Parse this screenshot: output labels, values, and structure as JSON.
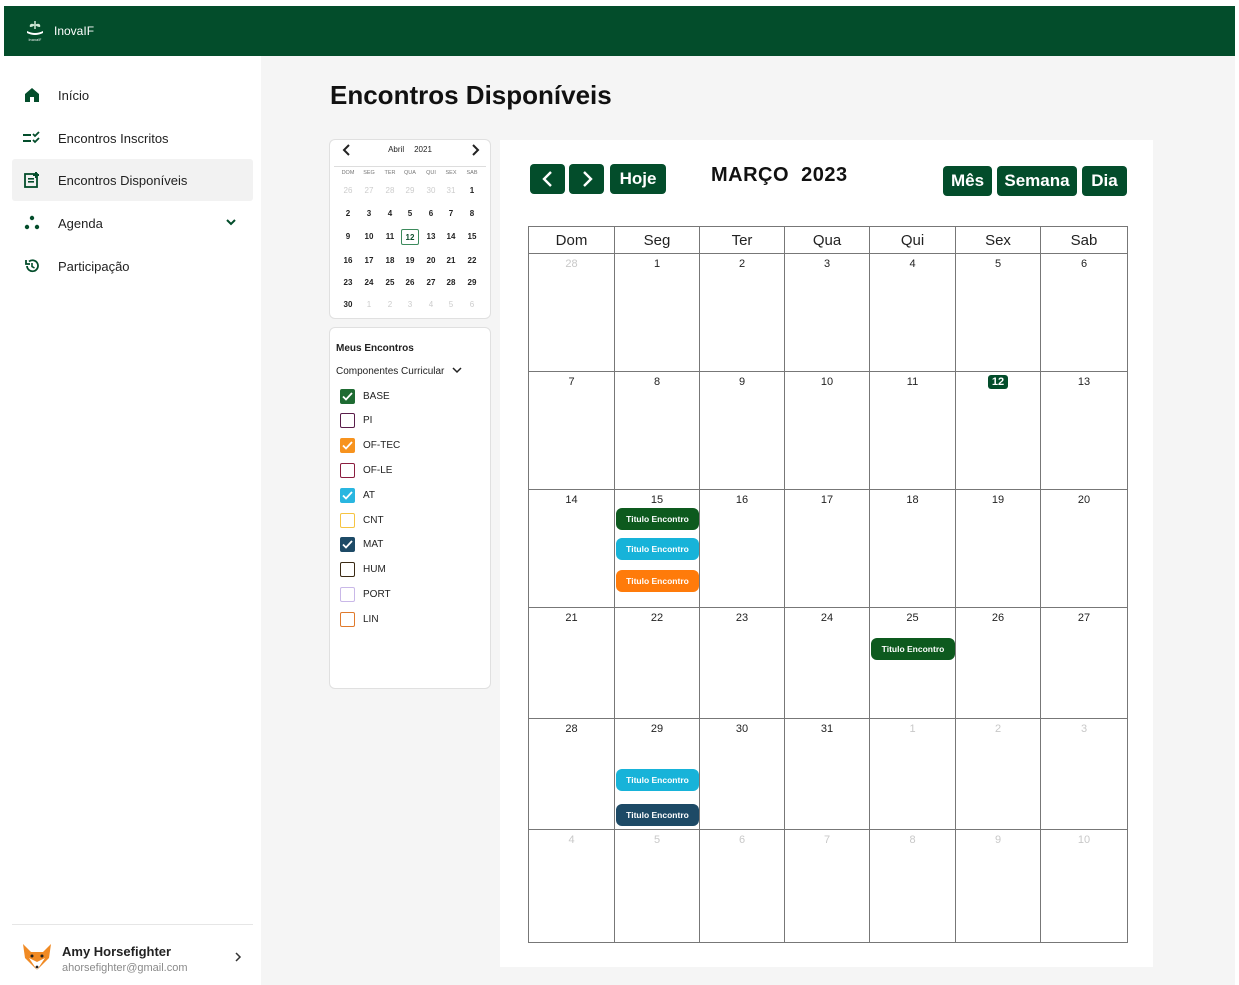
{
  "app": {
    "name": "InovaIF",
    "logo_text": "InovaIF"
  },
  "nav": {
    "items": [
      {
        "label": "Início",
        "icon": "home-icon"
      },
      {
        "label": "Encontros Inscritos",
        "icon": "checklist-icon"
      },
      {
        "label": "Encontros Disponíveis",
        "icon": "note-add-icon",
        "active": true
      },
      {
        "label": "Agenda",
        "icon": "dots-icon",
        "expandable": true
      },
      {
        "label": "Participação",
        "icon": "history-icon"
      }
    ]
  },
  "user": {
    "name": "Amy Horsefighter",
    "email": "ahorsefighter@gmail.com"
  },
  "page": {
    "title": "Encontros Disponíveis"
  },
  "mini_calendar": {
    "month": "Abril",
    "year": "2021",
    "weekdays": [
      "DOM",
      "SEG",
      "TER",
      "QUA",
      "QUI",
      "SEX",
      "SAB"
    ],
    "weeks": [
      [
        "26",
        "27",
        "28",
        "29",
        "30",
        "31",
        "1"
      ],
      [
        "2",
        "3",
        "4",
        "5",
        "6",
        "7",
        "8"
      ],
      [
        "9",
        "10",
        "11",
        "12",
        "13",
        "14",
        "15"
      ],
      [
        "16",
        "17",
        "18",
        "19",
        "20",
        "21",
        "22"
      ],
      [
        "23",
        "24",
        "25",
        "26",
        "27",
        "28",
        "29"
      ],
      [
        "30",
        "1",
        "2",
        "3",
        "4",
        "5",
        "6"
      ]
    ],
    "selected": "12"
  },
  "filters": {
    "title": "Meus Encontros",
    "group_label": "Componentes Curricular",
    "items": [
      {
        "label": "BASE",
        "checked": true,
        "color": "#1e6b32"
      },
      {
        "label": "PI",
        "checked": false,
        "color": "#5a1d4a"
      },
      {
        "label": "OF-TEC",
        "checked": true,
        "color": "#f7931e"
      },
      {
        "label": "OF-LE",
        "checked": false,
        "color": "#8b1d3f"
      },
      {
        "label": "AT",
        "checked": true,
        "color": "#29b6e0"
      },
      {
        "label": "CNT",
        "checked": false,
        "color": "#f6c442"
      },
      {
        "label": "MAT",
        "checked": true,
        "color": "#1d4a66"
      },
      {
        "label": "HUM",
        "checked": false,
        "color": "#3a2a14"
      },
      {
        "label": "PORT",
        "checked": false,
        "color": "#c9b8e8"
      },
      {
        "label": "LIN",
        "checked": false,
        "color": "#e07a2c"
      }
    ]
  },
  "calendar": {
    "title": "MARÇO  2023",
    "today_label": "Hoje",
    "views": [
      "Mês",
      "Semana",
      "Dia"
    ],
    "weekdays": [
      "Dom",
      "Seg",
      "Ter",
      "Qua",
      "Qui",
      "Sex",
      "Sab"
    ],
    "weeks": [
      [
        {
          "d": "28",
          "dim": true
        },
        {
          "d": "1"
        },
        {
          "d": "2"
        },
        {
          "d": "3"
        },
        {
          "d": "4"
        },
        {
          "d": "5"
        },
        {
          "d": "6"
        }
      ],
      [
        {
          "d": "7"
        },
        {
          "d": "8"
        },
        {
          "d": "9"
        },
        {
          "d": "10"
        },
        {
          "d": "11"
        },
        {
          "d": "12",
          "today": true
        },
        {
          "d": "13"
        }
      ],
      [
        {
          "d": "14"
        },
        {
          "d": "15"
        },
        {
          "d": "16"
        },
        {
          "d": "17"
        },
        {
          "d": "18"
        },
        {
          "d": "19"
        },
        {
          "d": "20"
        }
      ],
      [
        {
          "d": "21"
        },
        {
          "d": "22"
        },
        {
          "d": "23"
        },
        {
          "d": "24"
        },
        {
          "d": "25"
        },
        {
          "d": "26"
        },
        {
          "d": "27"
        }
      ],
      [
        {
          "d": "28"
        },
        {
          "d": "29"
        },
        {
          "d": "30"
        },
        {
          "d": "31"
        },
        {
          "d": "1",
          "dim": true
        },
        {
          "d": "2",
          "dim": true
        },
        {
          "d": "3",
          "dim": true
        }
      ],
      [
        {
          "d": "4",
          "dim": true
        },
        {
          "d": "5",
          "dim": true
        },
        {
          "d": "6",
          "dim": true
        },
        {
          "d": "7",
          "dim": true
        },
        {
          "d": "8",
          "dim": true
        },
        {
          "d": "9",
          "dim": true
        },
        {
          "d": "10",
          "dim": true
        }
      ]
    ],
    "events": [
      {
        "week": 2,
        "day": 1,
        "slot": 0,
        "label": "Titulo Encontro",
        "color": "#0d5a1e"
      },
      {
        "week": 2,
        "day": 1,
        "slot": 1,
        "label": "Titulo Encontro",
        "color": "#17b3d9"
      },
      {
        "week": 2,
        "day": 1,
        "slot": 2,
        "label": "Titulo Encontro",
        "color": "#ff7b0a"
      },
      {
        "week": 3,
        "day": 4,
        "slot": 0,
        "label": "Titulo Encontro",
        "color": "#0d5a1e"
      },
      {
        "week": 4,
        "day": 1,
        "slot": 1,
        "label": "Titulo Encontro",
        "color": "#17b3d9"
      },
      {
        "week": 4,
        "day": 1,
        "slot": 2,
        "label": "Titulo Encontro",
        "color": "#1d4a66"
      }
    ]
  }
}
